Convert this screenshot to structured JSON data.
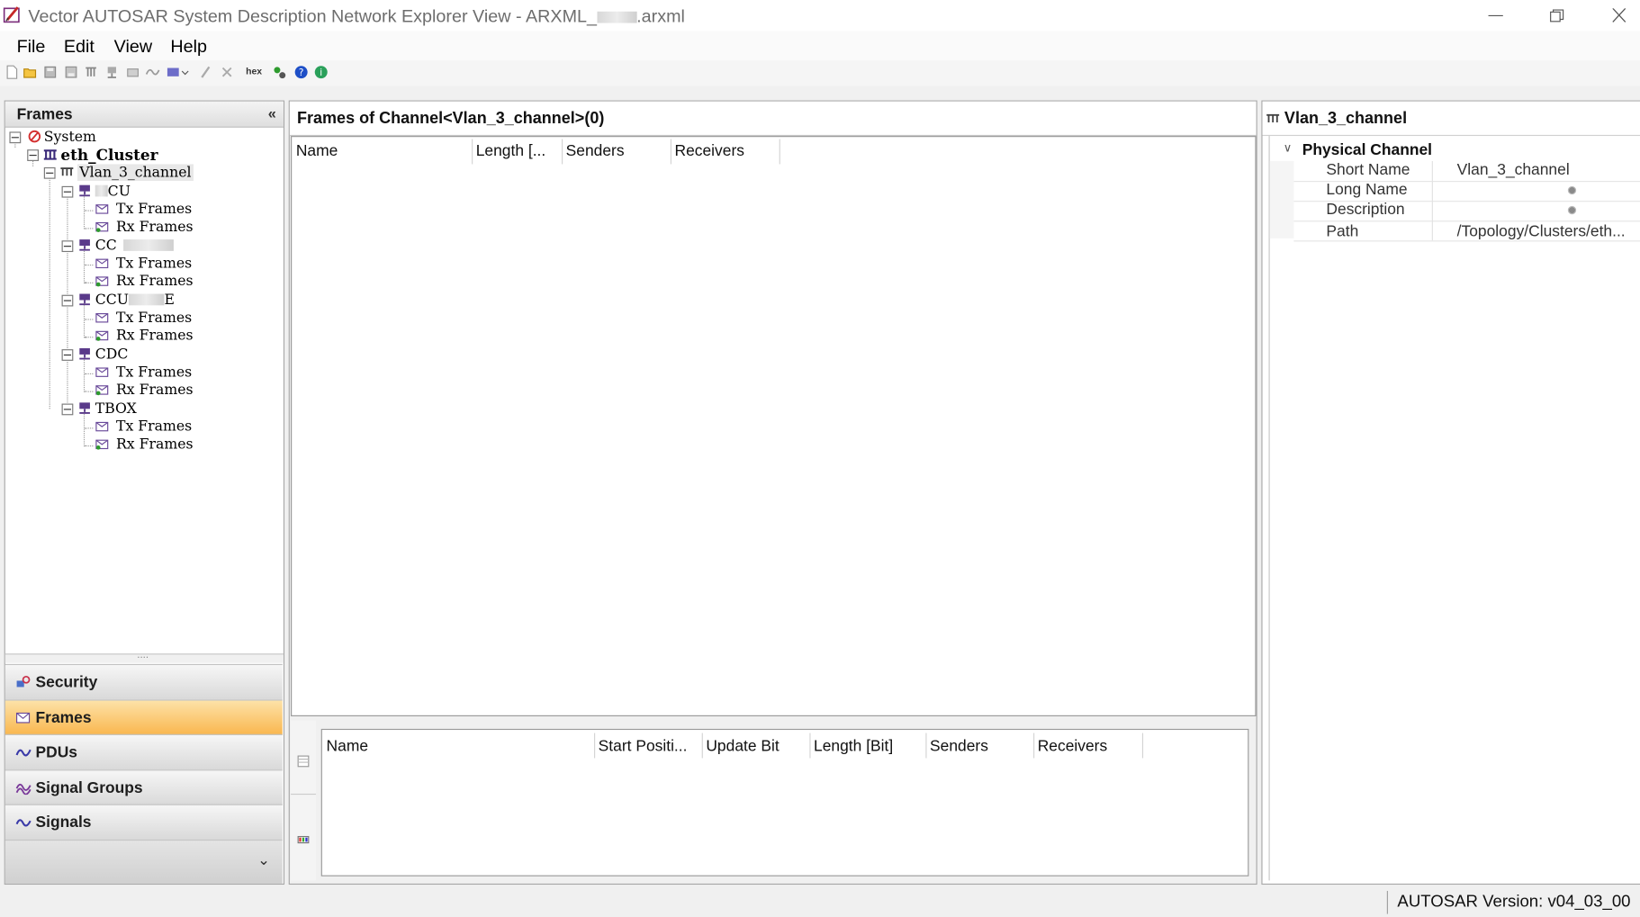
{
  "window": {
    "title": "Vector AUTOSAR System Description Network Explorer View - ARXML_",
    "title_suffix": ".arxml"
  },
  "menu": {
    "file": "File",
    "edit": "Edit",
    "view": "View",
    "help": "Help"
  },
  "toolbar": {
    "hex_label": "hex",
    "icons": [
      "new-icon",
      "open-icon",
      "save-icon",
      "save-all-icon",
      "network-icon",
      "ecu-icon",
      "folder-icon",
      "signal-icon",
      "dropdown-tool-icon",
      "edit-icon",
      "delete-icon",
      "hex-icon",
      "refresh-icon",
      "help-icon",
      "info-icon"
    ]
  },
  "left_panel": {
    "title": "Frames",
    "collapse_glyph": "«",
    "tree": {
      "system": "System",
      "cluster": "eth_Cluster",
      "channel": "Vlan_3_channel",
      "ecus": [
        {
          "name_prefix": "",
          "name_suffix": "CU",
          "tx": "Tx Frames",
          "rx": "Rx Frames"
        },
        {
          "name_prefix": "CC",
          "name_suffix": "",
          "tx": "Tx Frames",
          "rx": "Rx Frames"
        },
        {
          "name_prefix": "CCU",
          "name_suffix": "E",
          "tx": "Tx Frames",
          "rx": "Rx Frames"
        },
        {
          "name_prefix": "CDC",
          "name_suffix": "",
          "tx": "Tx Frames",
          "rx": "Rx Frames"
        },
        {
          "name_prefix": "TBOX",
          "name_suffix": "",
          "tx": "Tx Frames",
          "rx": "Rx Frames"
        }
      ]
    },
    "splitter_grip": "....",
    "nav": {
      "security": "Security",
      "frames": "Frames",
      "pdus": "PDUs",
      "signal_groups": "Signal Groups",
      "signals": "Signals",
      "more_glyph": "⌄"
    }
  },
  "center_panel": {
    "title": "Frames of Channel<Vlan_3_channel>(0)",
    "columns": [
      "Name",
      "Length [...",
      "Senders",
      "Receivers"
    ],
    "detail_columns": [
      "Name",
      "Start Positi...",
      "Update Bit",
      "Length [Bit]",
      "Senders",
      "Receivers"
    ]
  },
  "right_panel": {
    "title": "Vlan_3_channel",
    "section": "Physical Channel",
    "properties": [
      {
        "label": "Short Name",
        "value": "Vlan_3_channel"
      },
      {
        "label": "Long Name",
        "value": ""
      },
      {
        "label": "Description",
        "value": ""
      },
      {
        "label": "Path",
        "value": "/Topology/Clusters/eth..."
      }
    ]
  },
  "status": {
    "autosar_version": "AUTOSAR Version: v04_03_00"
  },
  "colors": {
    "active_nav": "#f9b64d",
    "panel_border": "#a8a8a8",
    "background": "#f0f0f0"
  }
}
